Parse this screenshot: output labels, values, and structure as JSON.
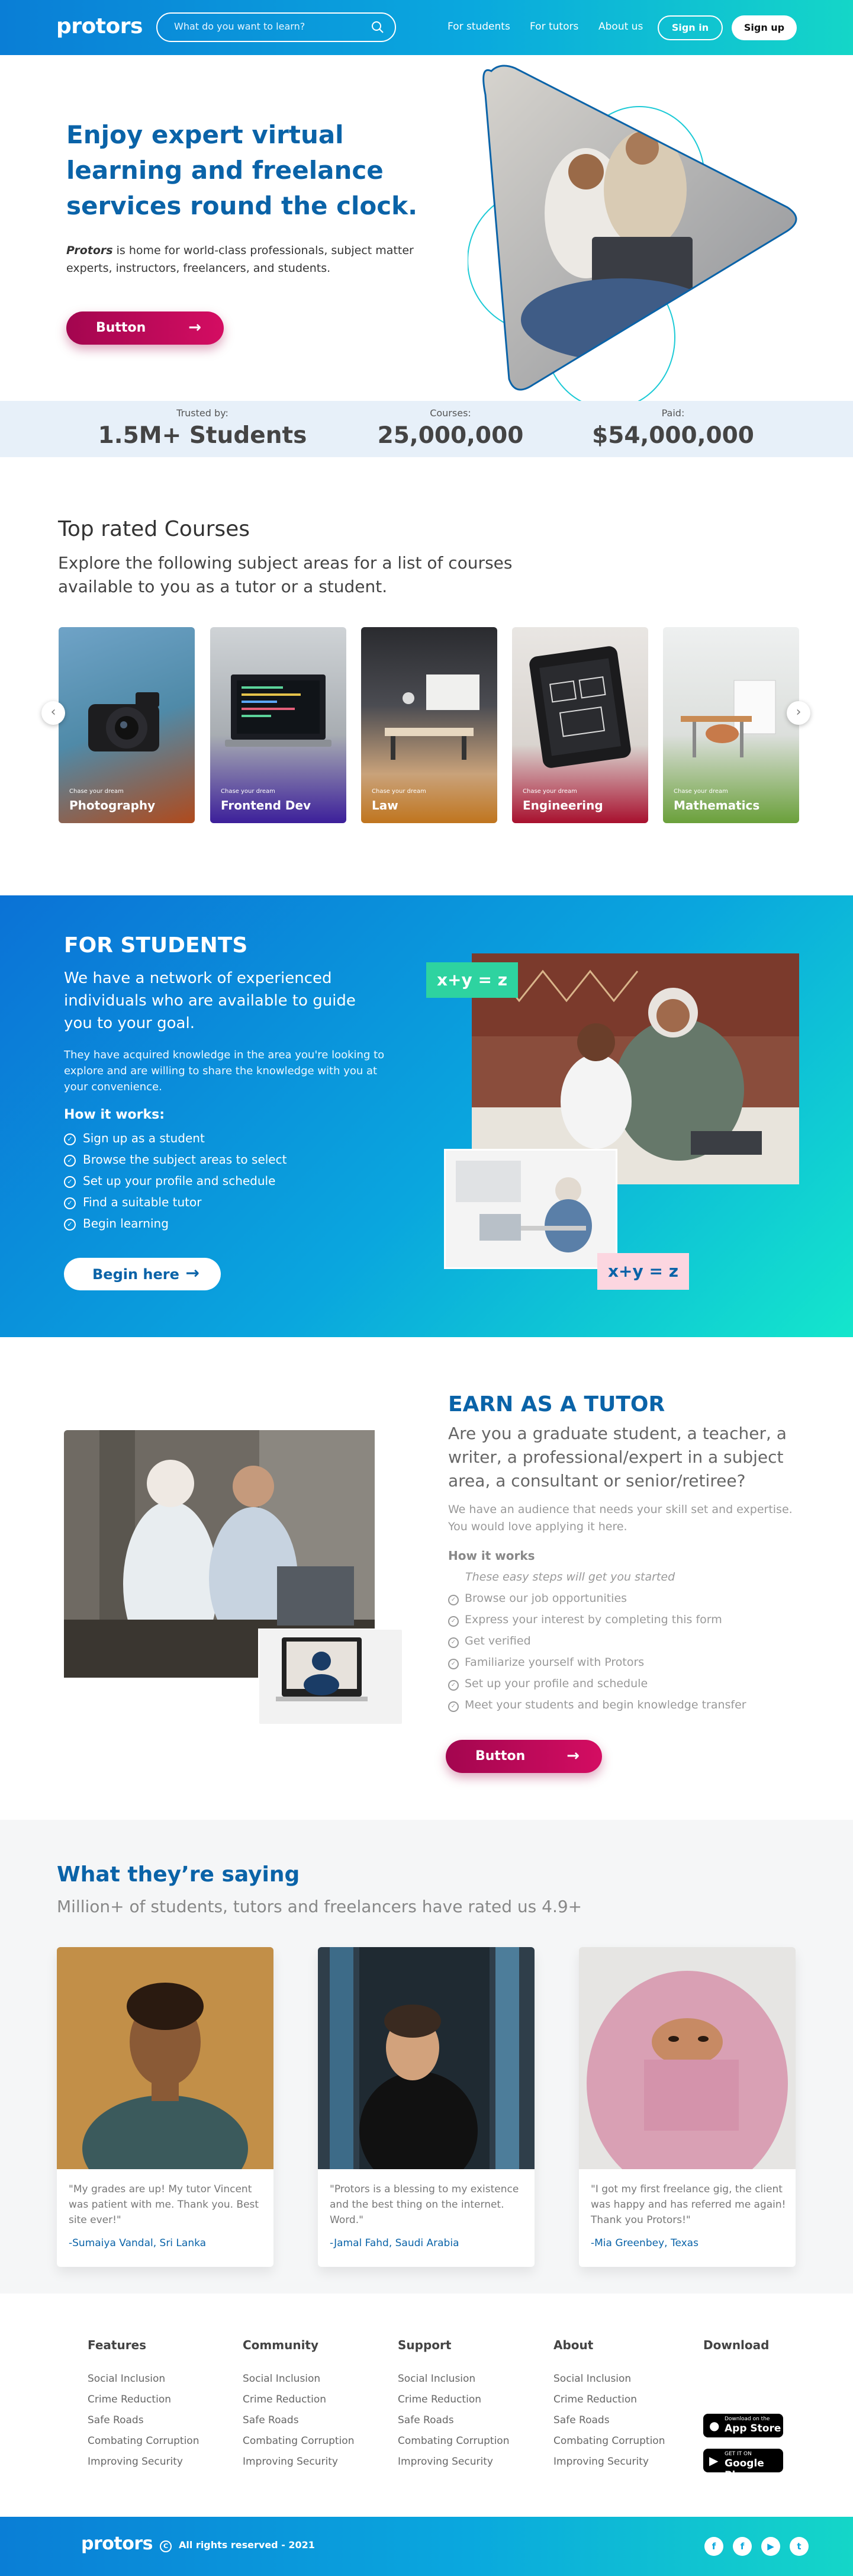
{
  "nav": {
    "logo": "protors",
    "search_placeholder": "What do you want to learn?",
    "links": [
      "For students",
      "For tutors",
      "About us"
    ],
    "signin": "Sign in",
    "signup": "Sign up"
  },
  "hero": {
    "title": "Enjoy expert virtual learning and freelance services round the clock.",
    "brand": "Protors",
    "desc": " is home for world-class professionals, subject matter experts, instructors, freelancers, and students.",
    "button": "Button"
  },
  "stats": [
    {
      "label": "Trusted by:",
      "value": "1.5M+ Students"
    },
    {
      "label": "Courses:",
      "value": "25,000,000"
    },
    {
      "label": "Paid:",
      "value": "$54,000,000"
    }
  ],
  "courses": {
    "title": "Top rated Courses",
    "subtitle": "Explore the following subject areas for a list of courses available to you as a tutor or a student.",
    "tagline": "Chase your dream",
    "items": [
      "Photography",
      "Frontend Dev",
      "Law",
      "Engineering",
      "Mathematics"
    ]
  },
  "students": {
    "heading": "FOR STUDENTS",
    "lead": "We have a network of experienced individuals who are available to guide you to your goal.",
    "para": "They have acquired knowledge in the area you're looking to explore and are willing to share the knowledge with you at your convenience.",
    "how": "How it works:",
    "steps": [
      "Sign up as a student",
      "Browse the subject areas to select",
      "Set up your profile and schedule",
      "Find a suitable tutor",
      "Begin learning"
    ],
    "button": "Begin here",
    "eq": "x+y = z"
  },
  "tutor": {
    "heading": "EARN AS A TUTOR",
    "lead": "Are you a graduate student, a teacher, a writer, a professional/expert in a subject area, a consultant or senior/retiree?",
    "para": "We have an audience that needs your skill set and expertise. You would love applying it here.",
    "how": "How it works",
    "intro": "These easy steps will get you started",
    "steps": [
      "Browse our job opportunities",
      "Express your interest by completing this form",
      "Get verified",
      "Familiarize yourself with Protors",
      "Set up your profile and schedule",
      "Meet your students and begin knowledge transfer"
    ],
    "button": "Button"
  },
  "testimonials": {
    "heading": "What they’re saying",
    "sub": "Million+ of students, tutors and freelancers have rated us 4.9+",
    "items": [
      {
        "quote": "\"My grades are up! My tutor Vincent was patient with me. Thank you. Best site ever!\"",
        "who": "-Sumaiya Vandal, Sri Lanka"
      },
      {
        "quote": "\"Protors is a blessing to my existence and the best thing on the internet. Word.\"",
        "who": "-Jamal Fahd, Saudi Arabia"
      },
      {
        "quote": "\"I got my first freelance gig, the client was happy and has referred me again! Thank you Protors!\"",
        "who": "-Mia Greenbey, Texas"
      }
    ]
  },
  "footer": {
    "cols": [
      {
        "title": "Features",
        "links": [
          "Social Inclusion",
          "Crime Reduction",
          "Safe Roads",
          "Combating Corruption",
          "Improving Security"
        ]
      },
      {
        "title": "Community",
        "links": [
          "Social Inclusion",
          "Crime Reduction",
          "Safe Roads",
          "Combating Corruption",
          "Improving Security"
        ]
      },
      {
        "title": "Support",
        "links": [
          "Social Inclusion",
          "Crime Reduction",
          "Safe Roads",
          "Combating Corruption",
          "Improving Security"
        ]
      },
      {
        "title": "About",
        "links": [
          "Social Inclusion",
          "Crime Reduction",
          "Safe Roads",
          "Combating Corruption",
          "Improving Security"
        ]
      }
    ],
    "download": "Download",
    "appstore_small": "Download on the",
    "appstore": "App Store",
    "gplay_small": "GET IT ON",
    "gplay": "Google Play",
    "logo": "protors",
    "copyright": "All rights reserved - 2021",
    "social_icons": [
      "facebook-icon",
      "facebook-icon",
      "youtube-icon",
      "twitter-icon"
    ]
  }
}
